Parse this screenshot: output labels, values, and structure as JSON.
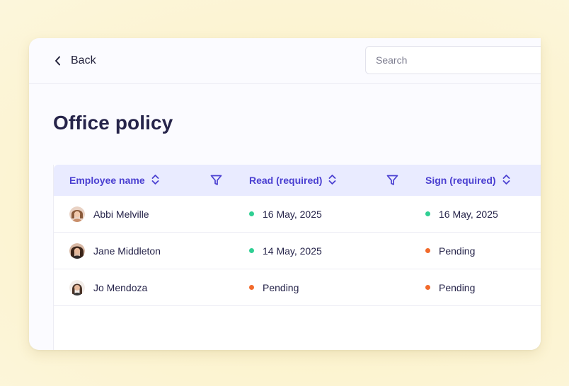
{
  "header": {
    "back_label": "Back",
    "search_placeholder": "Search"
  },
  "page": {
    "title": "Office policy"
  },
  "table": {
    "columns": [
      {
        "label": "Employee name",
        "sortable": true,
        "filterable": true
      },
      {
        "label": "Read (required)",
        "sortable": true,
        "filterable": true
      },
      {
        "label": "Sign (required)",
        "sortable": true,
        "filterable": false
      }
    ],
    "rows": [
      {
        "name": "Abbi Melville",
        "read": "16 May, 2025",
        "read_status": "done",
        "sign": "16 May, 2025",
        "sign_status": "done"
      },
      {
        "name": "Jane Middleton",
        "read": "14 May, 2025",
        "read_status": "done",
        "sign": "Pending",
        "sign_status": "pending"
      },
      {
        "name": "Jo Mendoza",
        "read": "Pending",
        "read_status": "pending",
        "sign": "Pending",
        "sign_status": "pending"
      }
    ]
  },
  "colors": {
    "accent": "#4a3fd1",
    "header_bg": "#e9ebff",
    "status_done": "#2fcf93",
    "status_pending": "#f26a2b",
    "text_primary": "#26244a"
  },
  "icons": {
    "back": "chevron-left-icon",
    "sort": "sort-updown-icon",
    "filter": "filter-funnel-icon"
  }
}
